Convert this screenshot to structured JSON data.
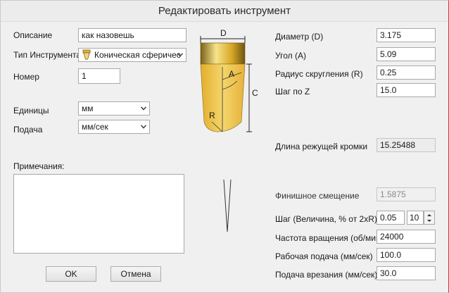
{
  "window": {
    "title": "Редактировать инструмент"
  },
  "left": {
    "description": {
      "label": "Описание",
      "value": "как назовешь"
    },
    "tool_type": {
      "label": "Тип Инструмента",
      "value": "Коническая сферичес"
    },
    "number": {
      "label": "Номер",
      "value": "1"
    },
    "units": {
      "label": "Единицы",
      "value": "мм"
    },
    "feed": {
      "label": "Подача",
      "value": "мм/сек"
    },
    "notes": {
      "label": "Примечания:",
      "value": ""
    }
  },
  "diagram": {
    "label_d": "D",
    "label_a": "A",
    "label_r": "R",
    "label_c": "C"
  },
  "right": {
    "diameter": {
      "label": "Диаметр (D)",
      "value": "3.175"
    },
    "angle": {
      "label": "Угол (A)",
      "value": "5.09"
    },
    "radius": {
      "label": "Радиус скругления (R)",
      "value": "0.25"
    },
    "z_step": {
      "label": "Шаг по Z",
      "value": "15.0"
    },
    "cut_length": {
      "label": "Длина режущей кромки",
      "value": "15.25488"
    },
    "finish_offset": {
      "label": "Финишное смещение",
      "value": "1.5875"
    },
    "stepover": {
      "label": "Шаг (Величина, % от 2xR)",
      "value": "0.05",
      "percent": "10"
    },
    "spindle": {
      "label": "Частота вращения (об/мин)",
      "value": "24000"
    },
    "work_feed": {
      "label": "Рабочая подача (мм/сек)",
      "value": "100.0"
    },
    "plunge_feed": {
      "label": "Подача врезания (мм/сек)",
      "value": "30.0"
    }
  },
  "buttons": {
    "ok": "OK",
    "cancel": "Отмена"
  },
  "colors": {
    "tool_gold": "#e7b73a",
    "tool_gold_light": "#f4d77a",
    "tool_gold_dark": "#6e5a14",
    "accent_border": "#cc3a3a"
  },
  "icons": {
    "tool_type": "conical-ball-tool-icon",
    "dropdown": "chevron-down-icon"
  }
}
